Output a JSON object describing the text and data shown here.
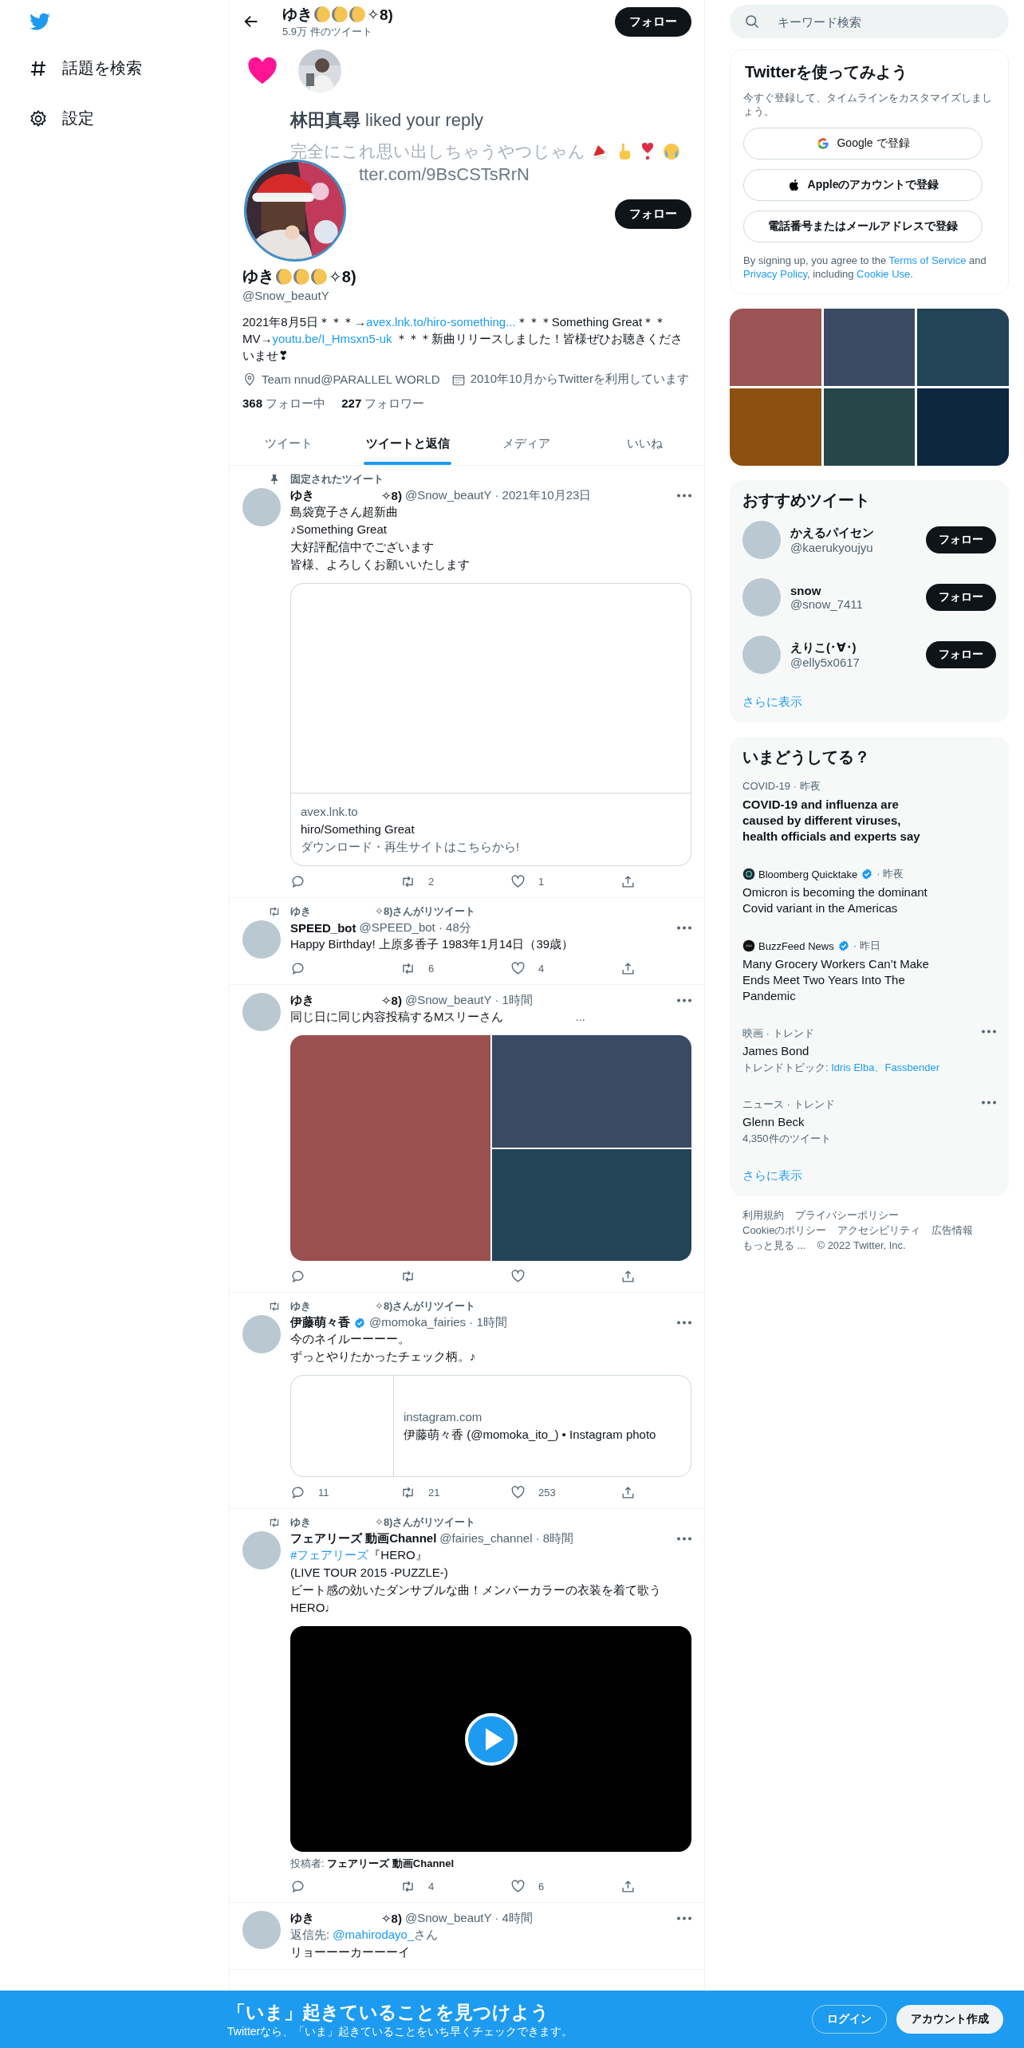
{
  "sidebar": {
    "items": [
      {
        "label": "話題を検索",
        "kind": "explore"
      },
      {
        "label": "設定",
        "kind": "settings"
      }
    ]
  },
  "header": {
    "name_prefix": "ゆき",
    "name_suffix": "✧8)",
    "tweet_count": "5.9万 件のツイート",
    "follow_button": "フォロー"
  },
  "banner": {
    "title": "**林田真尋** liked your reply",
    "quote": "完全にこれ思い出しちゃうやつじゃん",
    "link": "tter.com/9BsCSTsRrN"
  },
  "profile": {
    "follow_button": "フォロー",
    "name_prefix": "ゆき",
    "name_suffix": "✧8)",
    "handle": "@Snow_beautY",
    "bio": [
      {
        "kind": "text",
        "text": "2021年8月5日＊＊＊→"
      },
      {
        "kind": "link",
        "text": "avex.lnk.to/hiro-something..."
      },
      {
        "kind": "text",
        "text": "＊＊＊Something Great＊＊ MV→"
      },
      {
        "kind": "link",
        "text": "youtu.be/I_Hmsxn5-uk"
      },
      {
        "kind": "text",
        "text": " ＊＊＊新曲リリースしました！皆様ぜひお聴きくださいませ❣"
      }
    ],
    "location": "Team nnud@PARALLEL WORLD",
    "joined": "2010年10月からTwitterを利用しています",
    "stats": [
      {
        "count": "368",
        "label": "フォロー中"
      },
      {
        "count": "227",
        "label": "フォロワー"
      }
    ]
  },
  "tabs": [
    {
      "label": "ツイート",
      "selected": false
    },
    {
      "label": "ツイートと返信",
      "selected": true
    },
    {
      "label": "メディア",
      "selected": false
    },
    {
      "label": "いいね",
      "selected": false
    }
  ],
  "tweets": [
    {
      "kind": "card",
      "pinned_label": "固定されたツイート",
      "name_prefix": "ゆき",
      "name_suffix": "✧8)",
      "meta": "@Snow_beautY · 2021年10月23日",
      "verified": false,
      "lines": [
        {
          "text": "島袋寛子さん超新曲"
        },
        {
          "text": "♪Something Great"
        },
        {
          "text": "大好評配信中でございます"
        },
        {
          "text": "皆様、よろしくお願いいたします"
        }
      ],
      "card": {
        "kind": "large",
        "domain": "avex.lnk.to",
        "title": "hiro/Something Great",
        "description": "ダウンロード・再生サイトはこちらから!"
      },
      "retweets": "2",
      "likes": "1"
    },
    {
      "kind": "text",
      "retweeted_by": {
        "prefix": "ゆき",
        "suffix": "✧8)さんがリツイート"
      },
      "name_prefix": "SPEED_bot",
      "meta": "@SPEED_bot · 48分",
      "verified": false,
      "lines": [
        {
          "text": "Happy Birthday! 上原多香子 1983年1月14日（39歳）"
        }
      ],
      "retweets": "6",
      "likes": "4"
    },
    {
      "kind": "photos",
      "name_prefix": "ゆき",
      "name_suffix": "✧8)",
      "meta": "@Snow_beautY · 1時間",
      "verified": false,
      "lines": [
        {
          "text": "同じ日に同じ内容投稿するMスリーさん",
          "trailing": "..."
        }
      ],
      "photos": [
        {
          "color": "#9b5050"
        },
        {
          "color": "#3a4a63"
        },
        {
          "color": "#234357"
        }
      ]
    },
    {
      "kind": "card",
      "retweeted_by": {
        "prefix": "ゆき",
        "suffix": "✧8)さんがリツイート"
      },
      "name_prefix": "伊藤萌々香",
      "meta": "@momoka_fairies · 1時間",
      "verified": true,
      "lines": [
        {
          "text": "今のネイルーーーー。"
        },
        {
          "text": "ずっとやりたかったチェック柄。♪"
        }
      ],
      "card": {
        "kind": "small",
        "domain": "instagram.com",
        "title": "伊藤萌々香 (@momoka_ito_) • Instagram photo"
      },
      "replies": "11",
      "retweets": "21",
      "likes": "253"
    },
    {
      "kind": "video",
      "retweeted_by": {
        "prefix": "ゆき",
        "suffix": "✧8)さんがリツイート"
      },
      "name_prefix": "フェアリーズ 動画Channel",
      "meta": "@fairies_channel · 8時間",
      "verified": false,
      "lines": [
        {
          "link": "#フェアリーズ",
          "text": "『HERO』"
        },
        {
          "text": "(LIVE TOUR 2015 -PUZZLE-)"
        },
        {
          "text": "ビート感の効いたダンサブルな曲！メンバーカラーの衣装を着て歌う"
        },
        {
          "text": "HERO♩"
        }
      ],
      "video": {
        "caption_label": "投稿者:",
        "caption_name": "フェアリーズ 動画Channel"
      },
      "retweets": "4",
      "likes": "6"
    },
    {
      "kind": "reply",
      "name_prefix": "ゆき",
      "name_suffix": "✧8)",
      "meta": "@Snow_beautY · 4時間",
      "verified": false,
      "reply_to": {
        "label": "返信先:",
        "handle": "@mahirodayo_",
        "suffix": "さん"
      },
      "lines": [
        {
          "text": "リョーーーカーーーイ"
        }
      ]
    }
  ],
  "search": {
    "placeholder": "キーワード検索"
  },
  "signup": {
    "title": "Twitterを使ってみよう",
    "subtitle": "今すぐ登録して、タイムラインをカスタマイズしましょう。",
    "buttons": [
      {
        "kind": "google",
        "label": "Google で登録"
      },
      {
        "kind": "apple",
        "label": "Appleのアカウントで登録"
      },
      {
        "kind": "phone",
        "label": "電話番号またはメールアドレスで登録"
      }
    ],
    "legal": [
      {
        "kind": "text",
        "text": "By signing up, you agree to the "
      },
      {
        "kind": "link",
        "text": "Terms of Service"
      },
      {
        "kind": "text",
        "text": " and "
      },
      {
        "kind": "link",
        "text": "Privacy Policy"
      },
      {
        "kind": "text",
        "text": ", including "
      },
      {
        "kind": "link",
        "text": "Cookie Use."
      }
    ]
  },
  "media_tiles": [
    {
      "color": "#9b5353"
    },
    {
      "color": "#3a4a63"
    },
    {
      "color": "#234357"
    },
    {
      "color": "#8e500e"
    },
    {
      "color": "#26474a"
    },
    {
      "color": "#0e2640"
    }
  ],
  "recommended": {
    "title": "おすすめツイート",
    "more": "さらに表示",
    "users": [
      {
        "name": "かえるパイセン",
        "handle": "@kaerukyoujyu",
        "button": "フォロー"
      },
      {
        "name": "snow",
        "handle": "@snow_7411",
        "button": "フォロー"
      },
      {
        "name": "えりこ(･∀･)",
        "handle": "@elly5x0617",
        "button": "フォロー"
      }
    ]
  },
  "trends": {
    "title": "いまどうしてる？",
    "more": "さらに表示",
    "items": [
      {
        "kind": "news",
        "context": "COVID-19 · 昨夜",
        "headline": "COVID-19 and influenza are caused by different viruses, health officials and experts say"
      },
      {
        "kind": "source",
        "logo": {
          "kind": "ring"
        },
        "source": "Bloomberg Quicktake",
        "verified": true,
        "time": "· 昨夜",
        "headline": "Omicron is becoming the dominant Covid variant in the Americas"
      },
      {
        "kind": "source",
        "logo": {
          "kind": "dark"
        },
        "source": "BuzzFeed News",
        "verified": true,
        "time": "· 昨日",
        "headline": "Many Grocery Workers Can’t Make Ends Meet Two Years Into The Pandemic"
      },
      {
        "kind": "trend",
        "context": "映画 · トレンド",
        "title": "James Bond",
        "topics_label": "トレンドトピック:",
        "topics": "Idris Elba、Fassbender"
      },
      {
        "kind": "trend",
        "context": "ニュース · トレンド",
        "title": "Glenn Beck",
        "count": "4,350件のツイート"
      }
    ]
  },
  "footer": [
    [
      "利用規約",
      "プライバシーポリシー"
    ],
    [
      "Cookieのポリシー",
      "アクセシビリティ",
      "広告情報"
    ],
    [
      "もっと見る ...",
      "© 2022 Twitter, Inc."
    ]
  ],
  "bottom_bar": {
    "title": "「いま」起きていることを見つけよう",
    "subtitle": "Twitterなら、「いま」起きていることをいち早くチェックできます。",
    "login": "ログイン",
    "signup": "アカウント作成"
  }
}
